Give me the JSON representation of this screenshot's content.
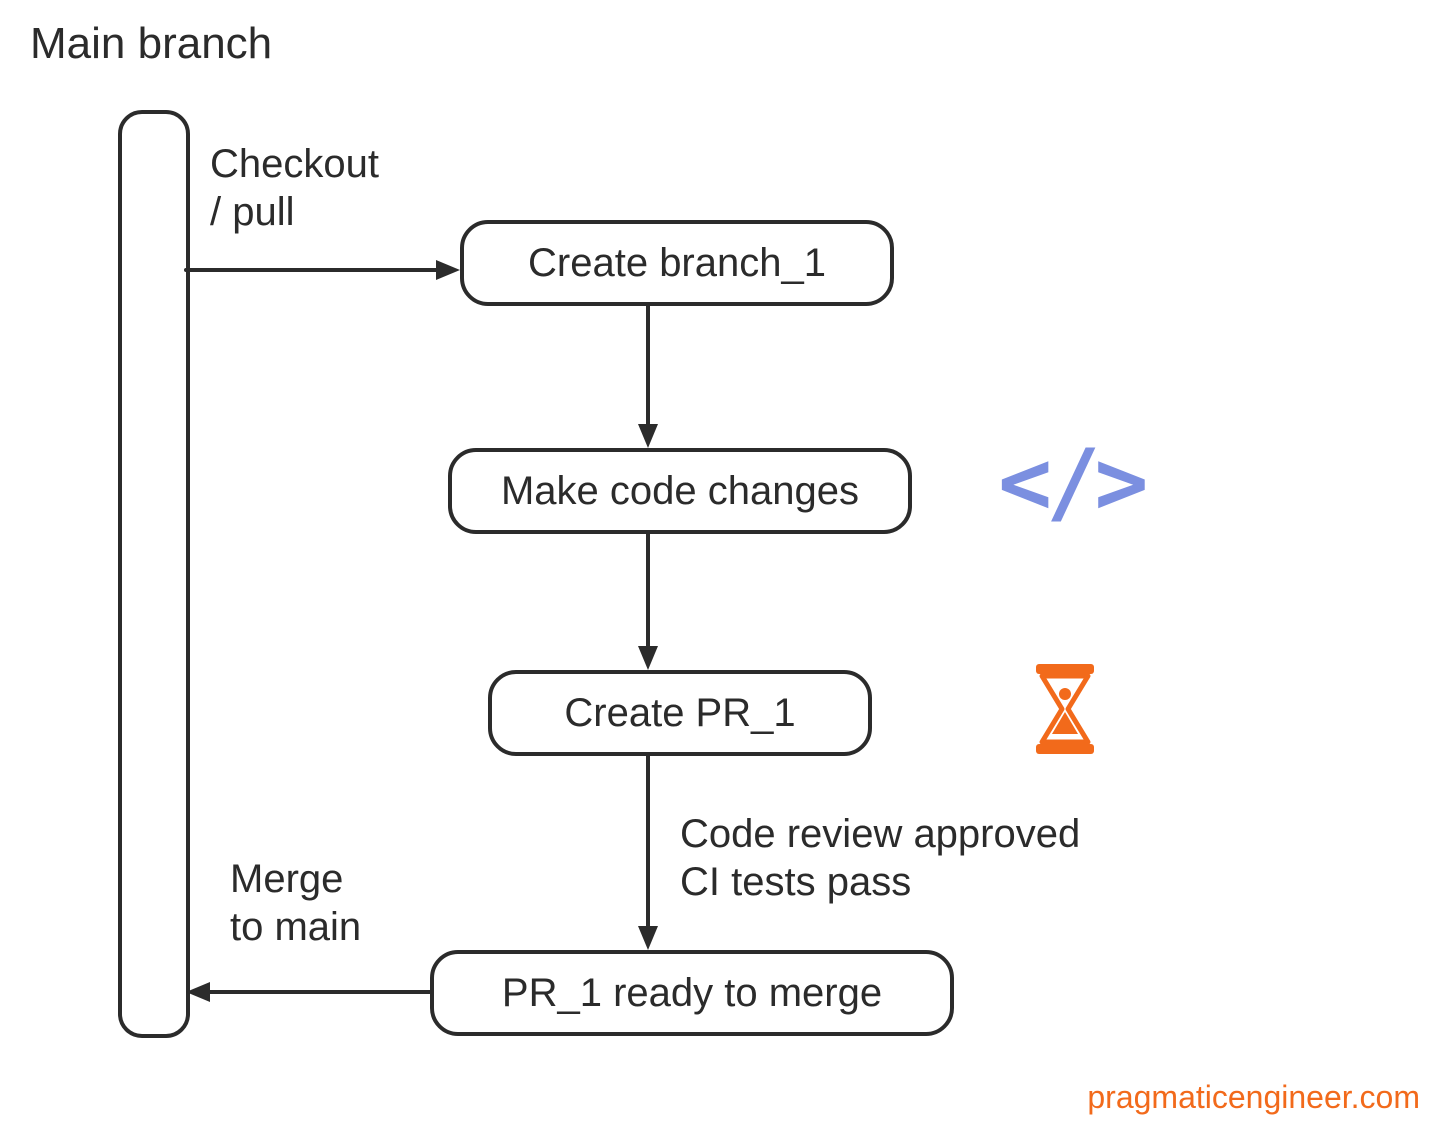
{
  "title": "Main branch",
  "nodes": {
    "create_branch": "Create branch_1",
    "make_changes": "Make code changes",
    "create_pr": "Create PR_1",
    "ready_merge": "PR_1 ready to merge"
  },
  "edges": {
    "checkout": "Checkout\n/ pull",
    "review": "Code review approved\nCI tests pass",
    "merge": "Merge\nto main"
  },
  "icons": {
    "code": "</>",
    "hourglass": "hourglass-icon"
  },
  "colors": {
    "stroke": "#2b2b2b",
    "code_icon": "#7b8fe0",
    "hourglass": "#f26a1b",
    "watermark": "#f26a1b"
  },
  "watermark": "pragmaticengineer.com"
}
